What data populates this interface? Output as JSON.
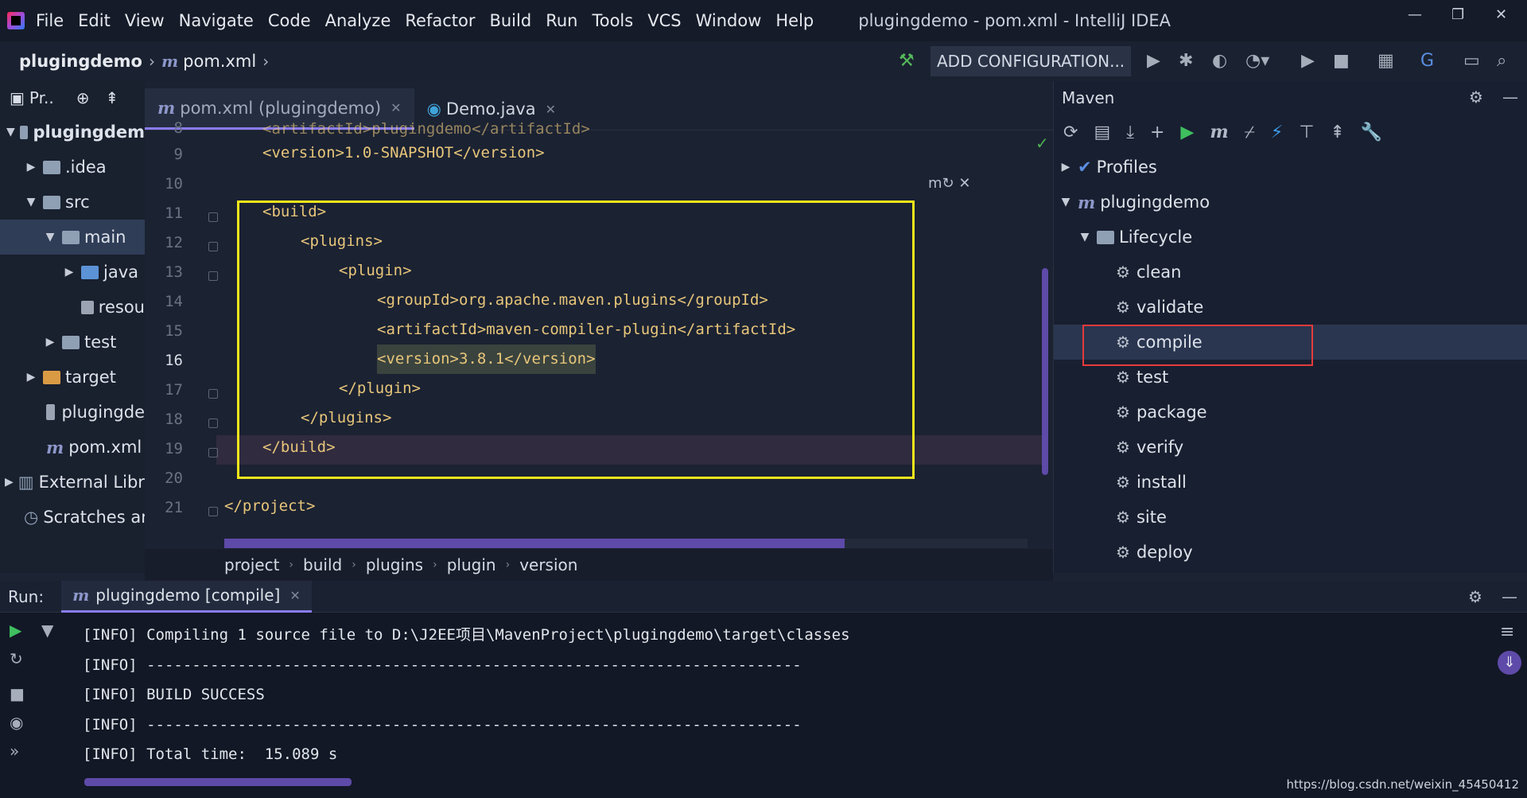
{
  "menubar": {
    "items": [
      "File",
      "Edit",
      "View",
      "Navigate",
      "Code",
      "Analyze",
      "Refactor",
      "Build",
      "Run",
      "Tools",
      "VCS",
      "Window",
      "Help"
    ],
    "window_title": "plugingdemo - pom.xml - IntelliJ IDEA"
  },
  "navbar": {
    "project": "plugingdemo",
    "file": "pom.xml",
    "run_config": "ADD CONFIGURATION..."
  },
  "project_panel": {
    "header": "Pr..",
    "items": [
      {
        "label": "plugingdem",
        "icon": "module-folder-icon",
        "expanded": true
      },
      {
        "label": ".idea",
        "icon": "folder-icon",
        "expanded": false
      },
      {
        "label": "src",
        "icon": "folder-icon",
        "expanded": true
      },
      {
        "label": "main",
        "icon": "folder-icon",
        "expanded": true
      },
      {
        "label": "java",
        "icon": "source-folder-icon",
        "expanded": false
      },
      {
        "label": "resou",
        "icon": "resources-folder-icon"
      },
      {
        "label": "test",
        "icon": "folder-icon",
        "expanded": false
      },
      {
        "label": "target",
        "icon": "excluded-folder-icon",
        "expanded": false
      },
      {
        "label": "plugingde",
        "icon": "iml-file-icon"
      },
      {
        "label": "pom.xml",
        "icon": "maven-file-icon"
      },
      {
        "label": "External Libra",
        "icon": "library-icon",
        "expanded": false
      },
      {
        "label": "Scratches an",
        "icon": "scratches-icon"
      }
    ]
  },
  "editor": {
    "tabs": [
      {
        "label": "pom.xml (plugingdemo)",
        "active": true
      },
      {
        "label": "Demo.java",
        "active": false
      }
    ],
    "lines": [
      {
        "n": "9",
        "text": "<version>1.0-SNAPSHOT</version>"
      },
      {
        "n": "10",
        "text": ""
      },
      {
        "n": "11",
        "text": "<build>"
      },
      {
        "n": "12",
        "text": "<plugins>"
      },
      {
        "n": "13",
        "text": "<plugin>"
      },
      {
        "n": "14",
        "text": "<groupId>org.apache.maven.plugins</groupId>"
      },
      {
        "n": "15",
        "text": "<artifactId>maven-compiler-plugin</artifactId>"
      },
      {
        "n": "16",
        "text": "<version>3.8.1</version>"
      },
      {
        "n": "17",
        "text": "</plugin>"
      },
      {
        "n": "18",
        "text": "</plugins>"
      },
      {
        "n": "19",
        "text": "</build>"
      },
      {
        "n": "20",
        "text": ""
      },
      {
        "n": "21",
        "text": "</project>"
      }
    ],
    "partial_top_line": "<artifactId>plugingdemo</artifactId>",
    "breadcrumb": [
      "project",
      "build",
      "plugins",
      "plugin",
      "version"
    ]
  },
  "maven": {
    "title": "Maven",
    "tree": [
      {
        "label": "Profiles",
        "level": 0
      },
      {
        "label": "plugingdemo",
        "level": 0
      },
      {
        "label": "Lifecycle",
        "level": 1
      },
      {
        "label": "clean",
        "level": 2
      },
      {
        "label": "validate",
        "level": 2
      },
      {
        "label": "compile",
        "level": 2
      },
      {
        "label": "test",
        "level": 2
      },
      {
        "label": "package",
        "level": 2
      },
      {
        "label": "verify",
        "level": 2
      },
      {
        "label": "install",
        "level": 2
      },
      {
        "label": "site",
        "level": 2
      },
      {
        "label": "deploy",
        "level": 2
      }
    ]
  },
  "run": {
    "label": "Run:",
    "tab": "plugingdemo [compile]",
    "console": [
      "[INFO] Compiling 1 source file to D:\\J2EE项目\\MavenProject\\plugingdemo\\target\\classes",
      "[INFO] ------------------------------------------------------------------------",
      "[INFO] BUILD SUCCESS",
      "[INFO] ------------------------------------------------------------------------",
      "[INFO] Total time:  15.089 s"
    ]
  },
  "watermark": "https://blog.csdn.net/weixin_45450412",
  "colors": {
    "accent": "#8a7cf0",
    "highlight_box": "#f4e61b",
    "compile_box": "#e53b3b",
    "xml_tag": "#e8c67a"
  }
}
